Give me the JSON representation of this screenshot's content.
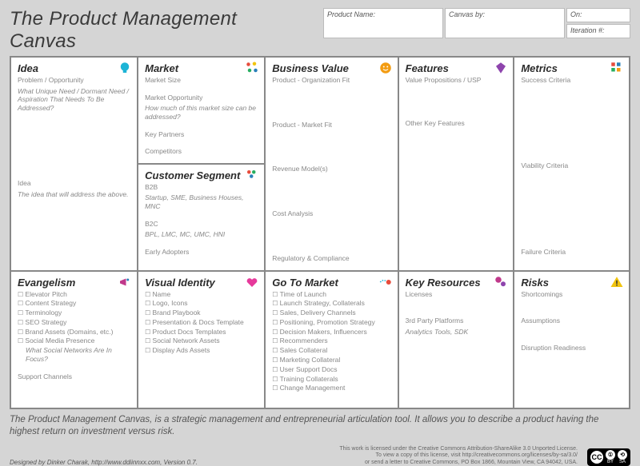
{
  "title": "The Product Management Canvas",
  "meta": {
    "product_name_label": "Product Name:",
    "canvas_by_label": "Canvas by:",
    "on_label": "On:",
    "iteration_label": "Iteration #:"
  },
  "cells": {
    "idea": {
      "title": "Idea",
      "l1": "Problem / Opportunity",
      "l1s": "What Unique Need / Dormant Need / Aspiration That Needs To Be Addressed?",
      "l2": "Idea",
      "l2s": "The idea that will address the above."
    },
    "market": {
      "title": "Market",
      "l1": "Market Size",
      "l2": "Market Opportunity",
      "l2s": "How much of this market size can be addressed?",
      "l3": "Key Partners",
      "l4": "Competitors"
    },
    "customer": {
      "title": "Customer Segment",
      "l1": "B2B",
      "l1s": "Startup, SME, Business Houses, MNC",
      "l2": "B2C",
      "l2s": "BPL, LMC, MC, UMC, HNI",
      "l3": "Early Adopters"
    },
    "bizval": {
      "title": "Business Value",
      "l1": "Product - Organization Fit",
      "l2": "Product - Market Fit",
      "l3": "Revenue  Model(s)",
      "l4": "Cost Analysis",
      "l5": "Regulatory & Compliance"
    },
    "features": {
      "title": "Features",
      "l1": "Value Propositions / USP",
      "l2": "Other Key Features"
    },
    "metrics": {
      "title": "Metrics",
      "l1": "Success Criteria",
      "l2": "Viability Criteria",
      "l3": "Failure Criteria"
    },
    "evangelism": {
      "title": "Evangelism",
      "items": [
        "Elevator Pitch",
        "Content Strategy",
        "Terminology",
        "SEO Strategy",
        "Brand Assets (Domains, etc.)",
        "Social Media Presence"
      ],
      "note": "What Social Networks Are In Focus?",
      "l2": "Support Channels"
    },
    "visual": {
      "title": "Visual Identity",
      "items": [
        "Name",
        "Logo, Icons",
        "Brand Playbook",
        "Presentation & Docs Template",
        "Product Docs Templates",
        "Social Network Assets",
        "Display Ads Assets"
      ]
    },
    "gtm": {
      "title": "Go To Market",
      "items": [
        "Time of Launch",
        "Launch Strategy, Collaterals",
        "Sales, Delivery Channels",
        "Positioning, Promotion Strategy",
        "Decision Makers, Influencers",
        "Recommenders",
        "Sales Collateral",
        "Marketing Collateral",
        "User Support Docs",
        "Training Collaterals",
        "Change Management"
      ]
    },
    "keyres": {
      "title": "Key Resources",
      "l1": "Licenses",
      "l2": "3rd Party Platforms",
      "l2s": "Analytics Tools, SDK"
    },
    "risks": {
      "title": "Risks",
      "l1": "Shortcomings",
      "l2": "Assumptions",
      "l3": "Disruption Readiness"
    }
  },
  "footer": "The Product Management Canvas, is a strategic management and entrepreneurial articulation tool. It allows you to describe a product having the highest return on investment versus risk.",
  "credits": {
    "author": "Designed by Dinker Charak, http://www.ddiinnxx.com, Version 0.7.",
    "lic1": "This work is licensed under the Creative Commons Attribution-ShareAlike 3.0 Unported License.",
    "lic2": "To view a copy of this license, visit http://creativecommons.org/licenses/by-sa/3.0/",
    "lic3": "or send a letter to Creative Commons, PO Box 1866, Mountain View, CA 94042, USA."
  }
}
